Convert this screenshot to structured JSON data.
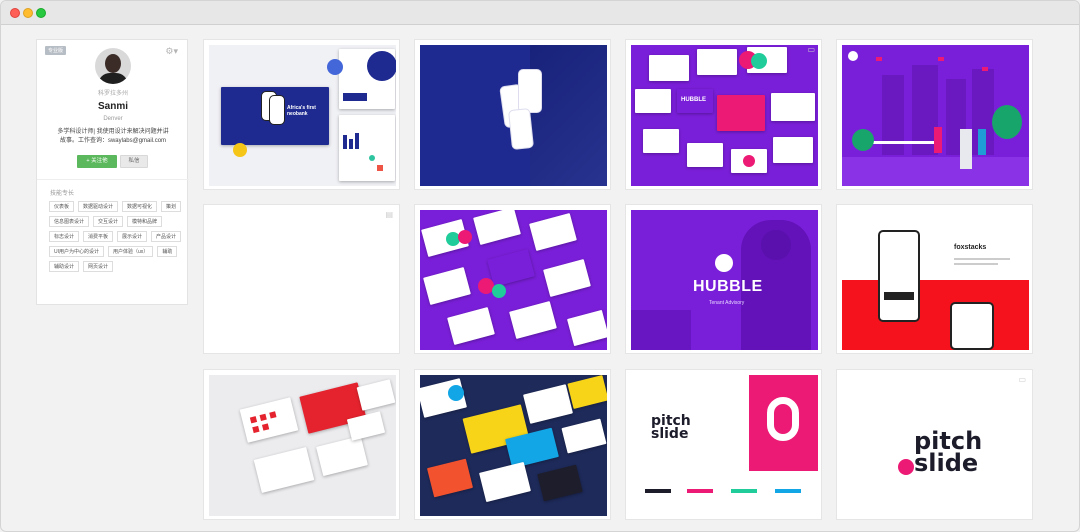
{
  "profile": {
    "badge": "专业版",
    "subtitle": "科罗拉多州",
    "name": "Sanmi",
    "location": "Denver",
    "bio_line1": "多学科设计师| 我使用设计来解决问题并讲",
    "bio_line2": "故事。工作查询：swaylabs@gmail.com",
    "follow_label": "+ 关注他",
    "message_label": "私信",
    "skills_title": "技能专长",
    "tags": [
      "仪表板",
      "数据驱动设计",
      "数据可视化",
      "策划",
      "信息图表设计",
      "交互设计",
      "模特和品牌",
      "标志设计",
      "消费平板",
      "展示设计",
      "产品设计",
      "UI用户为中心的设计",
      "用户体验（ux）",
      "辅助",
      "辅助设计",
      "网页设计"
    ]
  },
  "gallery": {
    "labels": {
      "africa_title": "Africa's first neobank",
      "hubble": "HUBBLE",
      "hubble_sub": "Tenant Advisory",
      "foxstacks": "foxstacks",
      "pitch": "pitch",
      "slide": "slide"
    }
  },
  "colors": {
    "purple": "#7a1fd9",
    "navy": "#1e2a8f",
    "pink": "#ec1a74",
    "red": "#f5121c"
  }
}
